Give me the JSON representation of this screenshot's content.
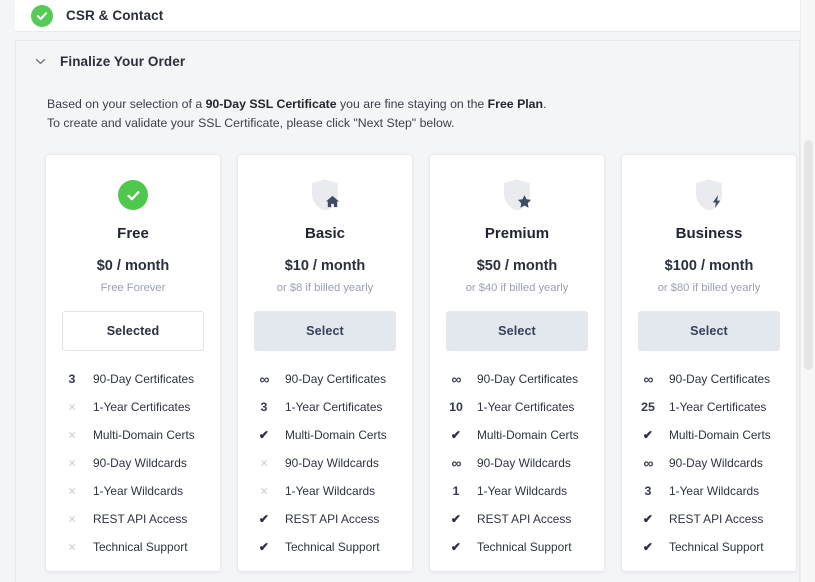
{
  "completed_step": {
    "label": "CSR & Contact",
    "icon": "check-circle-icon"
  },
  "panel": {
    "title": "Finalize Your Order",
    "chevron_icon": "chevron-down-icon",
    "description_line1_a": "Based on your selection of a ",
    "description_line1_b": "90-Day SSL Certificate",
    "description_line1_c": " you are fine staying on the ",
    "description_line1_d": "Free Plan",
    "description_line1_e": ".",
    "description_line2": "To create and validate your SSL Certificate, please click \"Next Step\" below."
  },
  "feature_names": [
    "90-Day Certificates",
    "1-Year Certificates",
    "Multi-Domain Certs",
    "90-Day Wildcards",
    "1-Year Wildcards",
    "REST API Access",
    "Technical Support"
  ],
  "plans": [
    {
      "name": "Free",
      "price": "$0 / month",
      "note": "Free Forever",
      "button_label": "Selected",
      "button_state": "selected",
      "icon": "green-check-circle-icon",
      "features": [
        {
          "mark": "3",
          "type": "num",
          "label": "90-Day Certificates"
        },
        {
          "mark": "×",
          "type": "cross",
          "label": "1-Year Certificates"
        },
        {
          "mark": "×",
          "type": "cross",
          "label": "Multi-Domain Certs"
        },
        {
          "mark": "×",
          "type": "cross",
          "label": "90-Day Wildcards"
        },
        {
          "mark": "×",
          "type": "cross",
          "label": "1-Year Wildcards"
        },
        {
          "mark": "×",
          "type": "cross",
          "label": "REST API Access"
        },
        {
          "mark": "×",
          "type": "cross",
          "label": "Technical Support"
        }
      ]
    },
    {
      "name": "Basic",
      "price": "$10 / month",
      "note": "or $8 if billed yearly",
      "button_label": "Select",
      "button_state": "select",
      "icon": "shield-home-icon",
      "features": [
        {
          "mark": "∞",
          "type": "inf",
          "label": "90-Day Certificates"
        },
        {
          "mark": "3",
          "type": "num",
          "label": "1-Year Certificates"
        },
        {
          "mark": "✔",
          "type": "tick",
          "label": "Multi-Domain Certs"
        },
        {
          "mark": "×",
          "type": "cross",
          "label": "90-Day Wildcards"
        },
        {
          "mark": "×",
          "type": "cross",
          "label": "1-Year Wildcards"
        },
        {
          "mark": "✔",
          "type": "tick",
          "label": "REST API Access"
        },
        {
          "mark": "✔",
          "type": "tick",
          "label": "Technical Support"
        }
      ]
    },
    {
      "name": "Premium",
      "price": "$50 / month",
      "note": "or $40 if billed yearly",
      "button_label": "Select",
      "button_state": "select",
      "icon": "shield-star-icon",
      "features": [
        {
          "mark": "∞",
          "type": "inf",
          "label": "90-Day Certificates"
        },
        {
          "mark": "10",
          "type": "num",
          "label": "1-Year Certificates"
        },
        {
          "mark": "✔",
          "type": "tick",
          "label": "Multi-Domain Certs"
        },
        {
          "mark": "∞",
          "type": "inf",
          "label": "90-Day Wildcards"
        },
        {
          "mark": "1",
          "type": "num",
          "label": "1-Year Wildcards"
        },
        {
          "mark": "✔",
          "type": "tick",
          "label": "REST API Access"
        },
        {
          "mark": "✔",
          "type": "tick",
          "label": "Technical Support"
        }
      ]
    },
    {
      "name": "Business",
      "price": "$100 / month",
      "note": "or $80 if billed yearly",
      "button_label": "Select",
      "button_state": "select",
      "icon": "shield-bolt-icon",
      "features": [
        {
          "mark": "∞",
          "type": "inf",
          "label": "90-Day Certificates"
        },
        {
          "mark": "25",
          "type": "num",
          "label": "1-Year Certificates"
        },
        {
          "mark": "✔",
          "type": "tick",
          "label": "Multi-Domain Certs"
        },
        {
          "mark": "∞",
          "type": "inf",
          "label": "90-Day Wildcards"
        },
        {
          "mark": "3",
          "type": "num",
          "label": "1-Year Wildcards"
        },
        {
          "mark": "✔",
          "type": "tick",
          "label": "REST API Access"
        },
        {
          "mark": "✔",
          "type": "tick",
          "label": "Technical Support"
        }
      ]
    }
  ],
  "colors": {
    "success_green": "#4ec94e",
    "page_bg": "#f4f5f7",
    "card_bg": "#ffffff",
    "select_button_bg": "#e3e7ee",
    "shield_gray": "#e9ebef",
    "icon_navy": "#3f4a63"
  }
}
